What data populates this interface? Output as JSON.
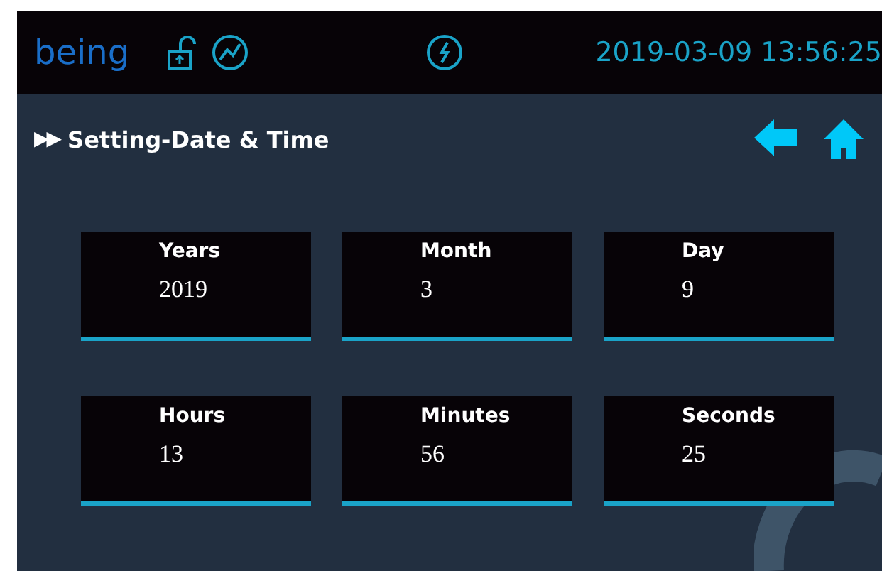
{
  "header": {
    "logo": "being",
    "datetime": "2019-03-09 13:56:25"
  },
  "title_bar": {
    "arrows": "▶▶",
    "title": "Setting-Date & Time"
  },
  "fields": [
    {
      "label": "Years",
      "value": "2019"
    },
    {
      "label": "Month",
      "value": "3"
    },
    {
      "label": "Day",
      "value": "9"
    },
    {
      "label": "Hours",
      "value": "13"
    },
    {
      "label": "Minutes",
      "value": "56"
    },
    {
      "label": "Seconds",
      "value": "25"
    }
  ]
}
